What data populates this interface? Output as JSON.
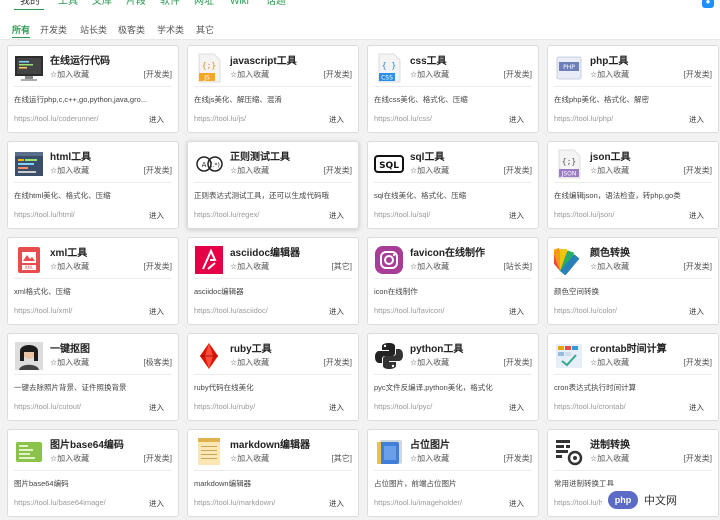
{
  "topnav": {
    "items": [
      "我的",
      "工具",
      "文库",
      "片段",
      "软件",
      "网址",
      "Wiki",
      "话题"
    ],
    "chat_icon": "chat-bubble-icon"
  },
  "filters": [
    "所有",
    "开发类",
    "站长类",
    "极客类",
    "学术类",
    "其它"
  ],
  "cards": [
    {
      "name": "在线运行代码",
      "fav": "加入收藏",
      "cat": "[开发类]",
      "desc": "在线运行php,c,c++,go,python,java,gro...",
      "url": "https://tool.lu/coderunner/",
      "go": "进入",
      "icon": "code-runner-icon"
    },
    {
      "name": "javascript工具",
      "fav": "加入收藏",
      "cat": "[开发类]",
      "desc": "在线js美化、解压缩、混淆",
      "url": "https://tool.lu/js/",
      "go": "进入",
      "icon": "javascript-file-icon"
    },
    {
      "name": "css工具",
      "fav": "加入收藏",
      "cat": "[开发类]",
      "desc": "在线css美化、格式化、压缩",
      "url": "https://tool.lu/css/",
      "go": "进入",
      "icon": "css-file-icon"
    },
    {
      "name": "php工具",
      "fav": "加入收藏",
      "cat": "[开发类]",
      "desc": "在线php美化、格式化、解密",
      "url": "https://tool.lu/php/",
      "go": "进入",
      "icon": "php-icon"
    },
    {
      "name": "html工具",
      "fav": "加入收藏",
      "cat": "[开发类]",
      "desc": "在线html美化、格式化、压缩",
      "url": "https://tool.lu/html/",
      "go": "进入",
      "icon": "html-editor-icon"
    },
    {
      "name": "正则测试工具",
      "fav": "加入收藏",
      "cat": "[开发类]",
      "desc": "正则表达式测试工具，还可以生成代码哦",
      "url": "https://tool.lu/regex/",
      "go": "进入",
      "icon": "regex-icon"
    },
    {
      "name": "sql工具",
      "fav": "加入收藏",
      "cat": "[开发类]",
      "desc": "sql在线美化、格式化、压缩",
      "url": "https://tool.lu/sql/",
      "go": "进入",
      "icon": "sql-icon"
    },
    {
      "name": "json工具",
      "fav": "加入收藏",
      "cat": "[开发类]",
      "desc": "在线编辑json，语法检查，转php,go类",
      "url": "https://tool.lu/json/",
      "go": "进入",
      "icon": "json-file-icon"
    },
    {
      "name": "xml工具",
      "fav": "加入收藏",
      "cat": "[开发类]",
      "desc": "xml格式化、压缩",
      "url": "https://tool.lu/xml/",
      "go": "进入",
      "icon": "xml-file-icon"
    },
    {
      "name": "asciidoc编辑器",
      "fav": "加入收藏",
      "cat": "[其它]",
      "desc": "asciidoc编辑器",
      "url": "https://tool.lu/asciidoc/",
      "go": "进入",
      "icon": "asciidoc-icon"
    },
    {
      "name": "favicon在线制作",
      "fav": "加入收藏",
      "cat": "[站长类]",
      "desc": "icon在线制作",
      "url": "https://tool.lu/favicon/",
      "go": "进入",
      "icon": "favicon-camera-icon"
    },
    {
      "name": "颜色转换",
      "fav": "加入收藏",
      "cat": "[开发类]",
      "desc": "颜色空间转换",
      "url": "https://tool.lu/color/",
      "go": "进入",
      "icon": "color-swatch-icon"
    },
    {
      "name": "一键抠图",
      "fav": "加入收藏",
      "cat": "[极客类]",
      "desc": "一键去除照片背景、证件照换背景",
      "url": "https://tool.lu/cutout/",
      "go": "进入",
      "icon": "portrait-photo-icon"
    },
    {
      "name": "ruby工具",
      "fav": "加入收藏",
      "cat": "[开发类]",
      "desc": "ruby代码在线美化",
      "url": "https://tool.lu/ruby/",
      "go": "进入",
      "icon": "ruby-gem-icon"
    },
    {
      "name": "python工具",
      "fav": "加入收藏",
      "cat": "[开发类]",
      "desc": "pyc文件反编译,python美化，格式化",
      "url": "https://tool.lu/pyc/",
      "go": "进入",
      "icon": "python-icon"
    },
    {
      "name": "crontab时间计算",
      "fav": "加入收藏",
      "cat": "[开发类]",
      "desc": "cron表达式执行时间计算",
      "url": "https://tool.lu/crontab/",
      "go": "进入",
      "icon": "crontab-schedule-icon"
    },
    {
      "name": "图片base64编码",
      "fav": "加入收藏",
      "cat": "[开发类]",
      "desc": "图片base64编码",
      "url": "https://tool.lu/base64image/",
      "go": "进入",
      "icon": "image-base64-icon"
    },
    {
      "name": "markdown编辑器",
      "fav": "加入收藏",
      "cat": "[其它]",
      "desc": "markdown编辑器",
      "url": "https://tool.lu/markdown/",
      "go": "进入",
      "icon": "markdown-notepad-icon"
    },
    {
      "name": "占位图片",
      "fav": "加入收藏",
      "cat": "[开发类]",
      "desc": "占位图片，前端占位图片",
      "url": "https://tool.lu/imageholder/",
      "go": "进入",
      "icon": "placeholder-image-icon"
    },
    {
      "name": "进制转换",
      "fav": "加入收藏",
      "cat": "[开发类]",
      "desc": "常用进制转换工具",
      "url": "https://tool.lu/hexconvert/",
      "go": "进入",
      "icon": "hex-convert-icon"
    }
  ],
  "watermark": {
    "logo": "php",
    "text": "中文网"
  }
}
